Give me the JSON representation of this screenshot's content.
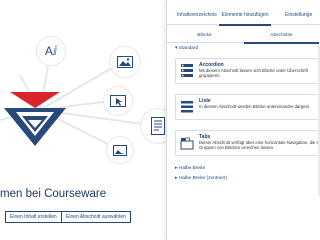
{
  "hero": {
    "welcome": "men bei Courseware",
    "create_content_button": "Einen Inhalt erstellen",
    "select_section_button": "Einen Abschnitt auswählen"
  },
  "sidebar": {
    "tabs": [
      "Inhaltsverzeichnis",
      "Elemente hinzufügen",
      "Einstellunge"
    ],
    "active_tab": 1,
    "subtabs": [
      "Blöcke",
      "Abschnitte"
    ],
    "active_subtab": 1,
    "sections": {
      "standard": "▾ Standard",
      "half": "▸ Halbe Breite",
      "half_centered": "▸ Halbe Breite (zentriert)"
    },
    "blocks": [
      {
        "title": "Accordion",
        "desc": "Mit diesem Abschnitt lassen sich Blöcke unter Überschrift gruppieren.",
        "icon": "accordion-icon"
      },
      {
        "title": "Liste",
        "desc": "In diesem Abschnitt werden Blöcke untereinander dargest",
        "icon": "list-icon"
      },
      {
        "title": "Tabs",
        "desc": "Dieser Abschnitt verfügt über eine horizontale Navigation, die sich Gruppen von Blöcken erreichen lassen.",
        "icon": "tabs-icon"
      }
    ]
  },
  "colors": {
    "primary": "#28497c",
    "accent_red": "#d7262a",
    "border": "#d9dde3"
  }
}
